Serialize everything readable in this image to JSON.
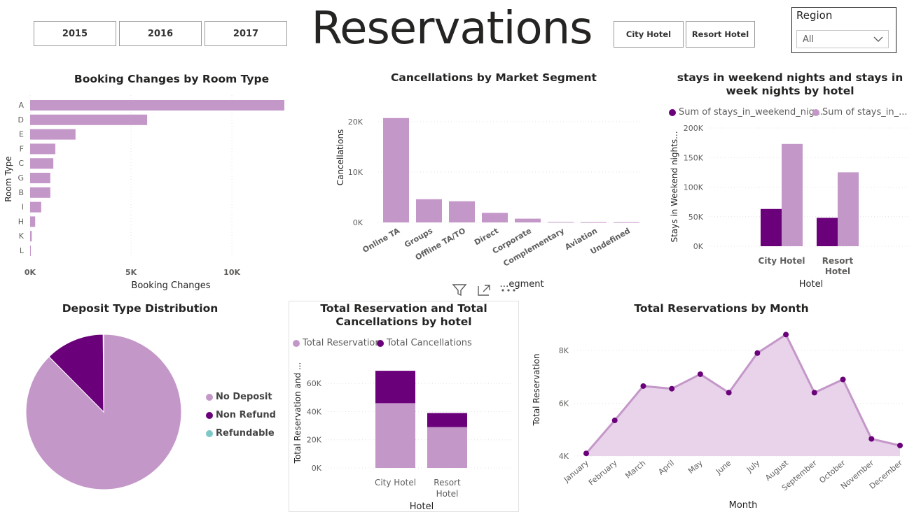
{
  "year_buttons": [
    "2015",
    "2016",
    "2017"
  ],
  "page_title": "Reservations",
  "hotel_buttons": [
    "City Hotel",
    "Resort Hotel"
  ],
  "region": {
    "label": "Region",
    "selected": "All"
  },
  "colors": {
    "light": "#c497c9",
    "dark": "#6b007b",
    "teal": "#7ec8c8",
    "area": "#e8d3ea"
  },
  "chart_data": [
    {
      "id": "booking_changes",
      "type": "bar",
      "orientation": "horizontal",
      "title": "Booking Changes by Room Type",
      "xlabel": "Booking Changes",
      "ylabel": "Room Type",
      "categories": [
        "A",
        "D",
        "E",
        "F",
        "C",
        "G",
        "B",
        "I",
        "H",
        "K",
        "L"
      ],
      "values": [
        12600,
        5800,
        2250,
        1250,
        1150,
        1000,
        1000,
        550,
        250,
        80,
        10
      ],
      "xlim": [
        0,
        12600
      ],
      "xticks": [
        0,
        5000,
        10000
      ],
      "xtick_labels": [
        "0K",
        "5K",
        "10K"
      ]
    },
    {
      "id": "cancellations_segment",
      "type": "bar",
      "title": "Cancellations by Market Segment",
      "xlabel": "…egment",
      "ylabel": "Cancellations",
      "categories": [
        "Online TA",
        "Groups",
        "Offline TA/TO",
        "Direct",
        "Corporate",
        "Complementary",
        "Aviation",
        "Undefined"
      ],
      "values": [
        20700,
        4600,
        4200,
        1900,
        750,
        100,
        50,
        50
      ],
      "ylim": [
        0,
        21500
      ],
      "yticks": [
        0,
        10000,
        20000
      ],
      "ytick_labels": [
        "0K",
        "10K",
        "20K"
      ]
    },
    {
      "id": "stays_by_hotel",
      "type": "bar",
      "title": "stays in weekend nights and stays in week nights by hotel",
      "xlabel": "Hotel",
      "ylabel": "Stays in Weekend nights...",
      "categories": [
        "City Hotel",
        "Resort Hotel"
      ],
      "category_lines": [
        [
          "City Hotel"
        ],
        [
          "Resort",
          "Hotel"
        ]
      ],
      "series": [
        {
          "name": "Sum of stays_in_weekend_nig...",
          "values": [
            63000,
            48000
          ]
        },
        {
          "name": "Sum of stays_in_...",
          "values": [
            173000,
            125000
          ]
        }
      ],
      "ylim": [
        0,
        200000
      ],
      "yticks": [
        0,
        50000,
        100000,
        150000,
        200000
      ],
      "ytick_labels": [
        "0K",
        "50K",
        "100K",
        "150K",
        "200K"
      ]
    },
    {
      "id": "deposit_type",
      "type": "pie",
      "title": "Deposit Type Distribution",
      "categories": [
        "No Deposit",
        "Non Refund",
        "Refundable"
      ],
      "values": [
        87.6,
        12.3,
        0.1
      ]
    },
    {
      "id": "reservation_cancel_hotel",
      "type": "bar",
      "stacked": true,
      "title": "Total Reservation and Total Cancellations by hotel",
      "xlabel": "Hotel",
      "ylabel": "Total Reservation and ...",
      "categories": [
        "City Hotel",
        "Resort Hotel"
      ],
      "category_lines": [
        [
          "City Hotel"
        ],
        [
          "Resort",
          "Hotel"
        ]
      ],
      "series": [
        {
          "name": "Total Reservation",
          "values": [
            46000,
            29000
          ]
        },
        {
          "name": "Total Cancellations",
          "values": [
            23000,
            10000
          ]
        }
      ],
      "ylim": [
        0,
        75000
      ],
      "yticks": [
        0,
        20000,
        40000,
        60000
      ],
      "ytick_labels": [
        "0K",
        "20K",
        "40K",
        "60K"
      ]
    },
    {
      "id": "reservations_month",
      "type": "area",
      "title": "Total Reservations by Month",
      "xlabel": "Month",
      "ylabel": "Total Reservation",
      "categories": [
        "January",
        "February",
        "March",
        "April",
        "May",
        "June",
        "July",
        "August",
        "September",
        "October",
        "November",
        "December"
      ],
      "values": [
        4100,
        5350,
        6650,
        6550,
        7100,
        6400,
        7900,
        8600,
        6400,
        6900,
        4650,
        4400
      ],
      "ylim": [
        4000,
        8900
      ],
      "yticks": [
        4000,
        6000,
        8000
      ],
      "ytick_labels": [
        "4K",
        "6K",
        "8K"
      ]
    }
  ]
}
